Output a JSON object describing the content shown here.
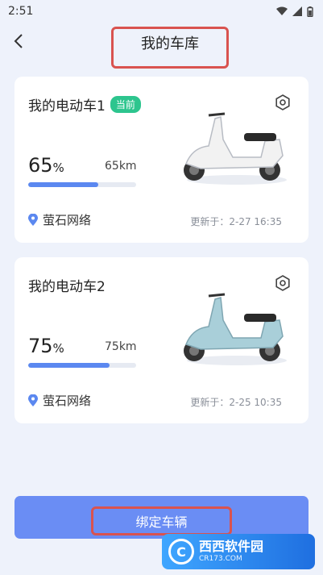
{
  "status": {
    "time": "2:51"
  },
  "header": {
    "title": "我的车库"
  },
  "vehicles": [
    {
      "name": "我的电动车1",
      "badge": "当前",
      "battery_number": "65",
      "battery_unit": "%",
      "battery_level": 0.65,
      "range": "65km",
      "location": "萤石网络",
      "updated": "更新于：2-27 16:35",
      "scooter_color": "#F2F2F2"
    },
    {
      "name": "我的电动车2",
      "battery_number": "75",
      "battery_unit": "%",
      "battery_level": 0.75,
      "range": "75km",
      "location": "萤石网络",
      "updated": "更新于：2-25 10:35",
      "scooter_color": "#A9CFD9"
    }
  ],
  "actions": {
    "bind_label": "绑定车辆"
  },
  "watermark": {
    "name": "西西软件园",
    "domain": "CR173.COM"
  },
  "colors": {
    "accent": "#6A8DF4",
    "badge": "#2DC58E",
    "highlight": "#D9534F"
  }
}
